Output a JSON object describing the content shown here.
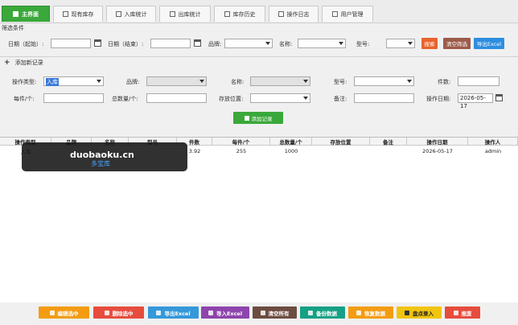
{
  "tabs": [
    {
      "label": "主界面",
      "active": true
    },
    {
      "label": "现有库存",
      "active": false
    },
    {
      "label": "入库统计",
      "active": false
    },
    {
      "label": "出库统计",
      "active": false
    },
    {
      "label": "库存历史",
      "active": false
    },
    {
      "label": "操作日志",
      "active": false
    },
    {
      "label": "用户管理",
      "active": false
    }
  ],
  "filter": {
    "title": "筛选条件",
    "date_start_label": "日期（起始）:",
    "date_end_label": "日期（结束）:",
    "brand_label": "品牌:",
    "name_label": "名称:",
    "model_label": "型号:",
    "search_button": "搜索",
    "clear_button": "清空筛选",
    "export_button": "导出Excel"
  },
  "add_record": {
    "toggle_label": "添加新记录",
    "op_type_label": "操作类型:",
    "op_type_value": "入库",
    "brand_label": "品牌:",
    "name_label": "名称:",
    "model_label": "型号:",
    "count_label": "件数:",
    "per_item_label": "每件/个:",
    "total_label": "总数量/个:",
    "location_label": "存放位置:",
    "remark_label": "备注:",
    "date_label": "操作日期:",
    "date_value": "2026-05-17",
    "submit_button": "添加记录"
  },
  "table": {
    "columns": [
      "操作类型",
      "品牌",
      "名称",
      "型号",
      "件数",
      "每件/个",
      "总数量/个",
      "存放位置",
      "备注",
      "操作日期",
      "操作人"
    ],
    "rows": [
      [
        "入库",
        "",
        "",
        "",
        "3.92",
        "255",
        "1000",
        "",
        "",
        "2026-05-17",
        "admin"
      ]
    ]
  },
  "watermark": {
    "line1": "duobaoku.cn",
    "line2": "多宝库"
  },
  "footer": {
    "buttons": [
      {
        "label": "编辑选中",
        "color": "#f39c12"
      },
      {
        "label": "删除选中",
        "color": "#e74c3c"
      },
      {
        "label": "导出Excel",
        "color": "#3498db"
      },
      {
        "label": "导入Excel",
        "color": "#8e44ad"
      },
      {
        "label": "清空所有",
        "color": "#6d4c41"
      },
      {
        "label": "备份数据",
        "color": "#16a085"
      },
      {
        "label": "恢复数据",
        "color": "#f39c12"
      },
      {
        "label": "盘点录入",
        "color": "#f1c40f"
      },
      {
        "label": "报废",
        "color": "#e74c3c"
      }
    ]
  },
  "colors": {
    "accent_green": "#3aa83a",
    "search_button": "#e8632c",
    "clear_button": "#9c5a4a",
    "export_button": "#2d8ee0",
    "add_button": "#3aa83a"
  }
}
